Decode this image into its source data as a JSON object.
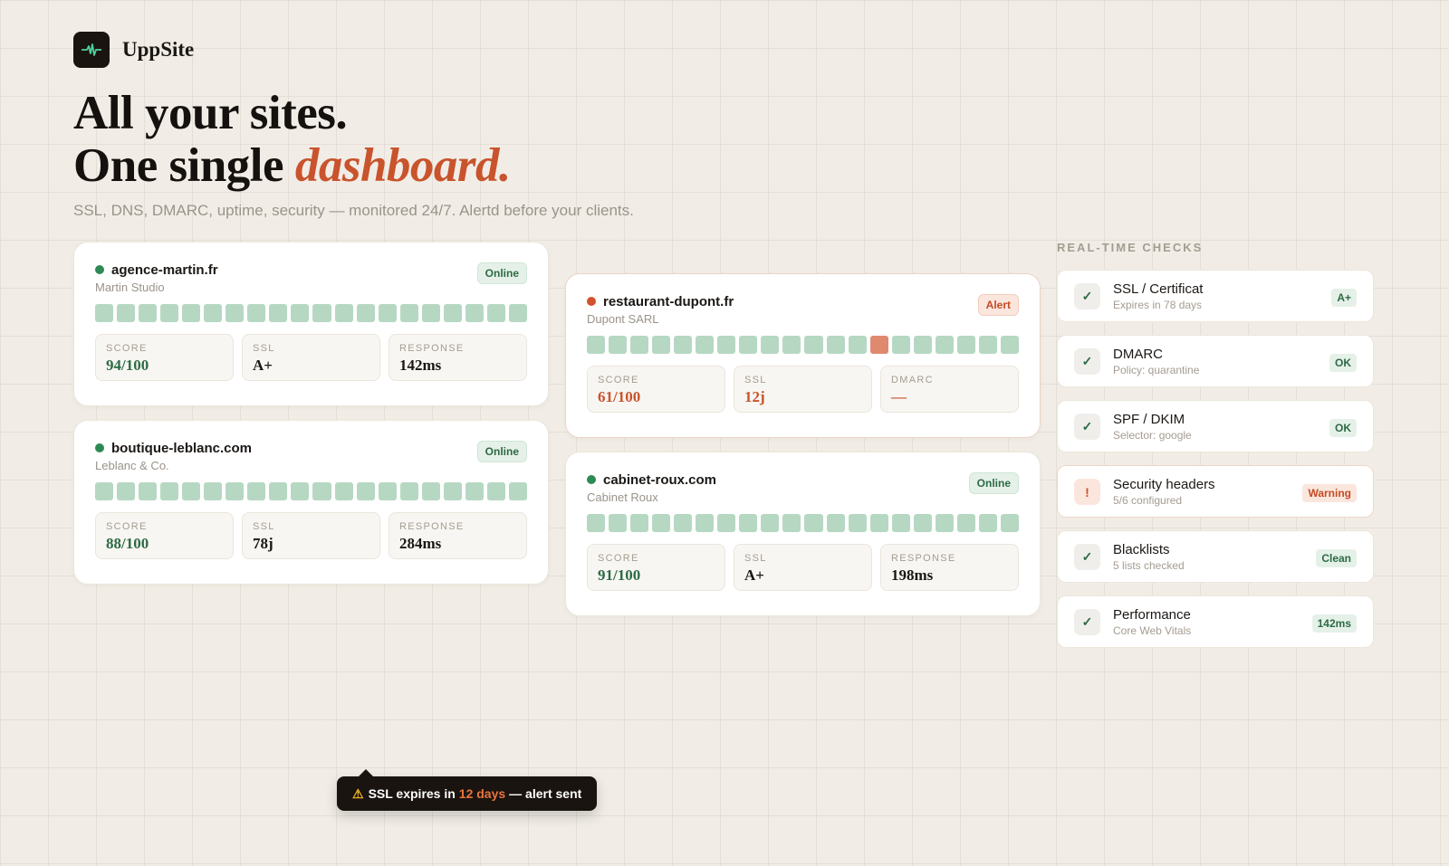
{
  "brand": {
    "name": "UppSite",
    "logo_icon": "pulse-icon"
  },
  "hero": {
    "line1": "All your sites.",
    "line2_prefix": "One single ",
    "line2_accent": "dashboard.",
    "subtitle": "SSL, DNS, DMARC, uptime, security — monitored 24/7. Alertd before your clients."
  },
  "sites": [
    {
      "domain": "agence-martin.fr",
      "company": "Martin Studio",
      "status": "Online",
      "status_type": "online",
      "stats": [
        {
          "label": "SCORE",
          "value": "94/100"
        },
        {
          "label": "SSL",
          "value": "A+"
        },
        {
          "label": "RESPONSE",
          "value": "142ms"
        }
      ]
    },
    {
      "domain": "boutique-leblanc.com",
      "company": "Leblanc & Co.",
      "status": "Online",
      "status_type": "online",
      "stats": [
        {
          "label": "SCORE",
          "value": "88/100"
        },
        {
          "label": "SSL",
          "value": "78j"
        },
        {
          "label": "RESPONSE",
          "value": "284ms"
        }
      ]
    },
    {
      "domain": "restaurant-dupont.fr",
      "company": "Dupont SARL",
      "status": "Alert",
      "status_type": "alert",
      "stats": [
        {
          "label": "SCORE",
          "value": "61/100"
        },
        {
          "label": "SSL",
          "value": "12j"
        },
        {
          "label": "DMARC",
          "value": "—"
        }
      ]
    },
    {
      "domain": "cabinet-roux.com",
      "company": "Cabinet Roux",
      "status": "Online",
      "status_type": "online",
      "stats": [
        {
          "label": "SCORE",
          "value": "91/100"
        },
        {
          "label": "SSL",
          "value": "A+"
        },
        {
          "label": "RESPONSE",
          "value": "198ms"
        }
      ]
    }
  ],
  "checks": {
    "title": "REAL-TIME CHECKS",
    "items": [
      {
        "name": "SSL / Certificat",
        "sub": "Expires in 78 days",
        "badge": "A+",
        "type": "ok",
        "icon": "check-icon"
      },
      {
        "name": "DMARC",
        "sub": "Policy: quarantine",
        "badge": "OK",
        "type": "ok",
        "icon": "check-icon"
      },
      {
        "name": "SPF / DKIM",
        "sub": "Selector: google",
        "badge": "OK",
        "type": "ok",
        "icon": "check-icon"
      },
      {
        "name": "Security headers",
        "sub": "5/6 configured",
        "badge": "Warning",
        "type": "warn",
        "icon": "exclamation-icon",
        "icon_glyph": "!"
      },
      {
        "name": "Blacklists",
        "sub": "5 lists checked",
        "badge": "Clean",
        "type": "ok",
        "icon": "check-icon"
      },
      {
        "name": "Performance",
        "sub": "Core Web Vitals",
        "badge": "142ms",
        "type": "ok",
        "icon": "check-icon"
      }
    ]
  },
  "toast": {
    "icon": "warning-icon",
    "icon_glyph": "⚠",
    "prefix": "SSL expires in",
    "highlight": "12 days",
    "suffix": "— alert sent"
  },
  "colors": {
    "accent": "#c9532c",
    "good": "#2d6a45",
    "uptime_ok": "#b6d8c3",
    "uptime_bad": "#df8a6e"
  }
}
